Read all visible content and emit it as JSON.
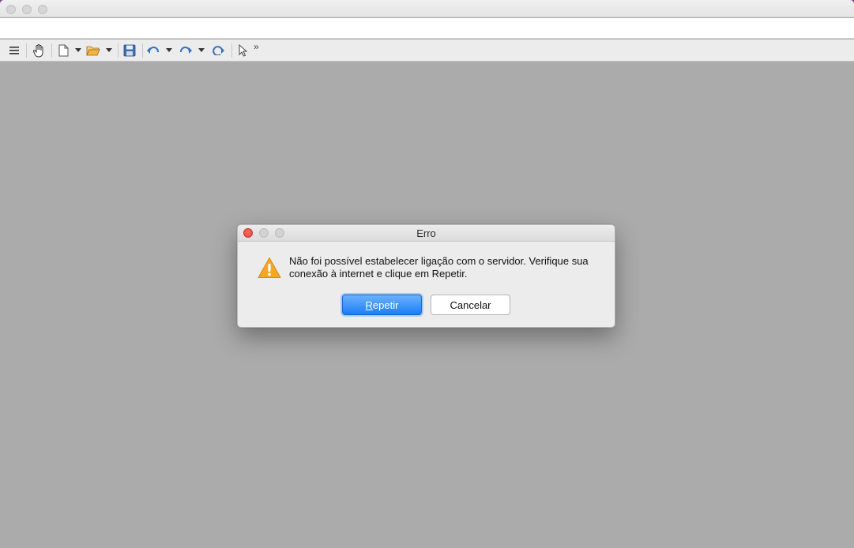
{
  "toolbar": {
    "items": [
      {
        "name": "menu-icon"
      },
      {
        "name": "hand-tool-icon"
      },
      {
        "name": "new-document-icon"
      },
      {
        "name": "open-folder-icon"
      },
      {
        "name": "save-icon"
      },
      {
        "name": "undo-icon"
      },
      {
        "name": "redo-icon"
      },
      {
        "name": "refresh-icon"
      },
      {
        "name": "pointer-icon"
      }
    ],
    "overflow": "»"
  },
  "dialog": {
    "title": "Erro",
    "message": "Não foi possível estabelecer ligação com o servidor. Verifique sua conexão à internet e clique em Repetir.",
    "primary_button": {
      "mnemonic": "R",
      "rest": "epetir"
    },
    "secondary_button": "Cancelar",
    "icon": "warning-icon"
  },
  "colors": {
    "accent": "#1a7ef5",
    "warning": "#f5a623",
    "backdrop": "#ababab"
  }
}
